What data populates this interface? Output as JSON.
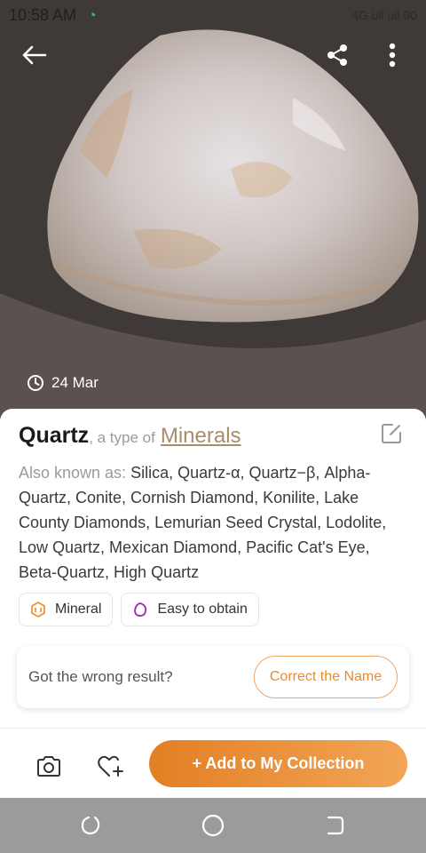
{
  "status_bar": {
    "time": "10:58 AM",
    "right_text": "4G  ull  ull  90"
  },
  "hero": {
    "date": "24 Mar",
    "icons": [
      "back-arrow-icon",
      "share-icon",
      "more-vertical-icon",
      "clock-icon"
    ]
  },
  "result": {
    "name": "Quartz",
    "type_prefix": ", a type of ",
    "type_link": "Minerals",
    "aka_label": "Also known as: ",
    "aka_text": "Silica, Quartz-α, Quartz−β, Alpha-Quartz, Conite, Cornish Diamond, Konilite, Lake County Diamonds, Lemurian Seed Crystal, Lodolite, Low Quartz, Mexican Diamond, Pacific Cat's Eye, Beta-Quartz, High Quartz"
  },
  "chips": [
    {
      "label": "Mineral",
      "icon": "gem-icon"
    },
    {
      "label": "Easy to obtain",
      "icon": "egg-icon"
    }
  ],
  "feedback": {
    "question": "Got the wrong result?",
    "button": "Correct the Name"
  },
  "actions": {
    "add_label": "+ Add to My Collection"
  },
  "colors": {
    "accent": "#ef8a2a",
    "link": "#a98c6a",
    "nav_bar": "#9b9b9b"
  }
}
